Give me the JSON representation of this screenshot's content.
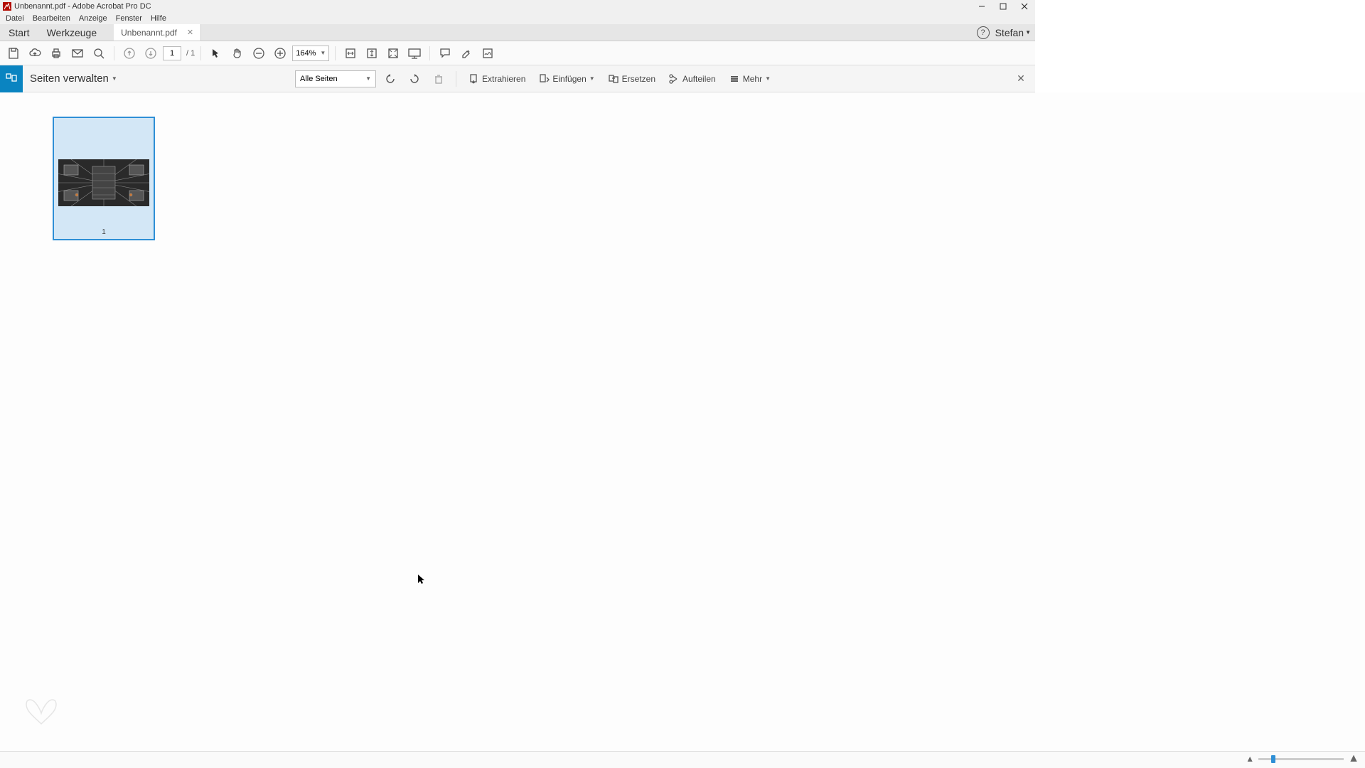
{
  "window": {
    "title": "Unbenannt.pdf - Adobe Acrobat Pro DC"
  },
  "menu": {
    "items": [
      "Datei",
      "Bearbeiten",
      "Anzeige",
      "Fenster",
      "Hilfe"
    ]
  },
  "tabs": {
    "nav": [
      "Start",
      "Werkzeuge"
    ],
    "document": {
      "label": "Unbenannt.pdf"
    },
    "user": "Stefan"
  },
  "toolbar": {
    "page_current": "1",
    "page_total": "/ 1",
    "zoom": "164%"
  },
  "actionbar": {
    "mode": "Seiten verwalten",
    "filter": "Alle Seiten",
    "buttons": {
      "extract": "Extrahieren",
      "insert": "Einfügen",
      "replace": "Ersetzen",
      "split": "Aufteilen",
      "more": "Mehr"
    }
  },
  "thumbnails": [
    {
      "page": "1"
    }
  ]
}
